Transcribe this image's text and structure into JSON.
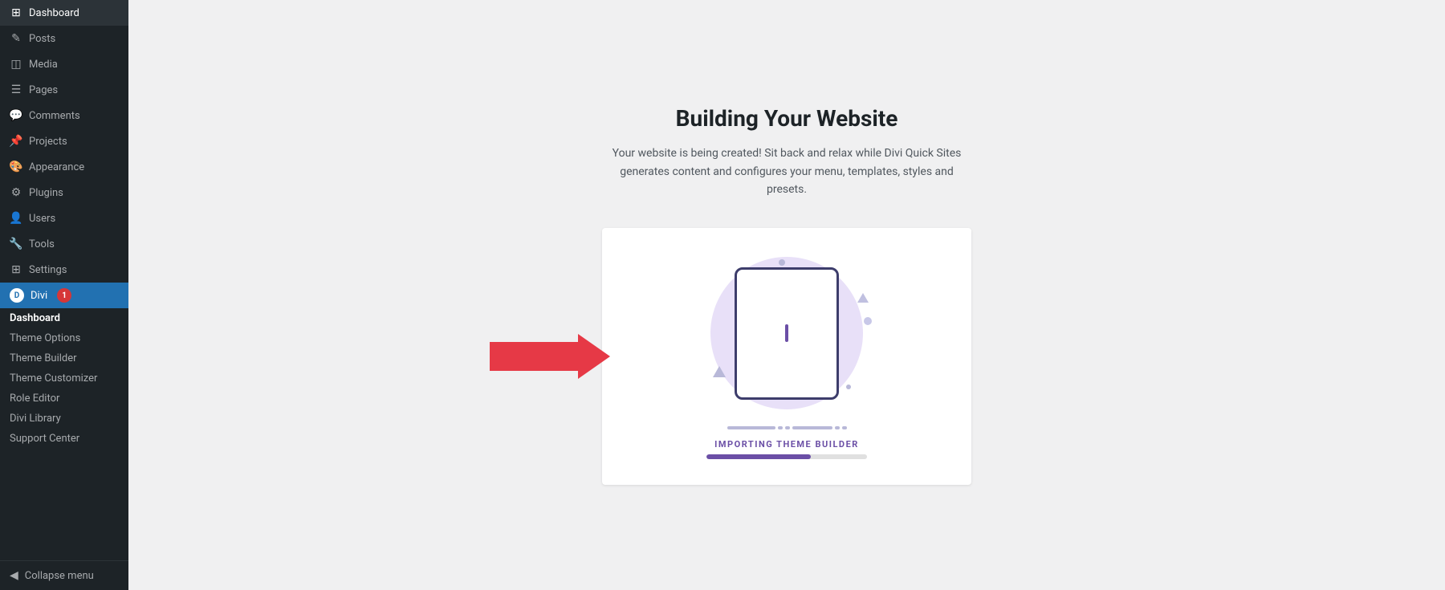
{
  "sidebar": {
    "items": [
      {
        "id": "dashboard",
        "label": "Dashboard",
        "icon": "⊞"
      },
      {
        "id": "posts",
        "label": "Posts",
        "icon": "✎"
      },
      {
        "id": "media",
        "label": "Media",
        "icon": "⊡"
      },
      {
        "id": "pages",
        "label": "Pages",
        "icon": "☰"
      },
      {
        "id": "comments",
        "label": "Comments",
        "icon": "💬"
      },
      {
        "id": "projects",
        "label": "Projects",
        "icon": "📌"
      },
      {
        "id": "appearance",
        "label": "Appearance",
        "icon": "🎨"
      },
      {
        "id": "plugins",
        "label": "Plugins",
        "icon": "⚙"
      },
      {
        "id": "users",
        "label": "Users",
        "icon": "👤"
      },
      {
        "id": "tools",
        "label": "Tools",
        "icon": "🔧"
      },
      {
        "id": "settings",
        "label": "Settings",
        "icon": "⊞"
      }
    ],
    "divi": {
      "label": "Divi",
      "badge": "1",
      "submenu": [
        {
          "id": "divi-dashboard",
          "label": "Dashboard",
          "active": true
        },
        {
          "id": "theme-options",
          "label": "Theme Options"
        },
        {
          "id": "theme-builder",
          "label": "Theme Builder"
        },
        {
          "id": "theme-customizer",
          "label": "Theme Customizer"
        },
        {
          "id": "role-editor",
          "label": "Role Editor"
        },
        {
          "id": "divi-library",
          "label": "Divi Library"
        },
        {
          "id": "support-center",
          "label": "Support Center"
        }
      ]
    },
    "collapse_label": "Collapse menu"
  },
  "main": {
    "title": "Building Your Website",
    "subtitle": "Your website is being created! Sit back and relax while Divi Quick Sites generates content and configures your menu, templates, styles and presets.",
    "importing_label": "IMPORTING THEME BUILDER",
    "progress_percent": 65
  }
}
